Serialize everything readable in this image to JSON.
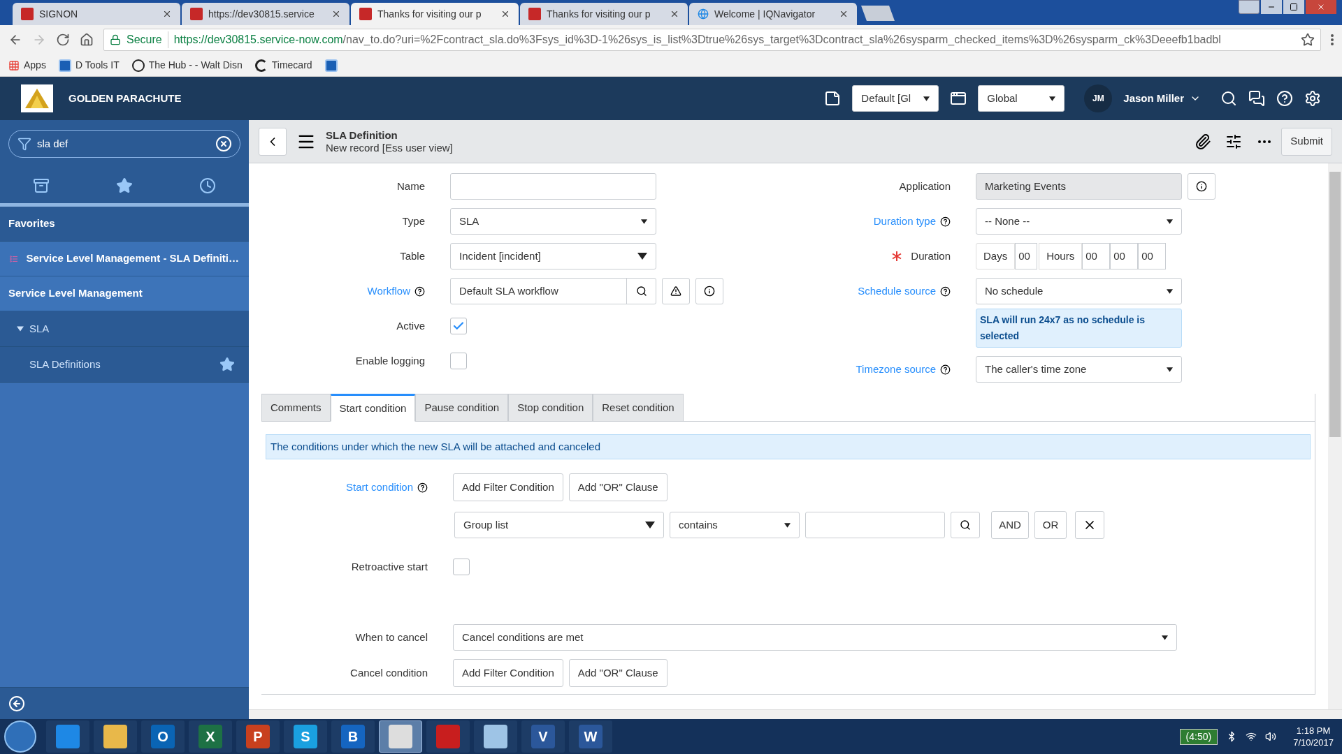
{
  "browser": {
    "tabs": [
      {
        "title": "SIGNON",
        "selected": false
      },
      {
        "title": "https://dev30815.service",
        "selected": false
      },
      {
        "title": "Thanks for visiting our p",
        "selected": true
      },
      {
        "title": "Thanks for visiting our p",
        "selected": false
      },
      {
        "title": "Welcome | IQNavigator",
        "selected": false
      }
    ],
    "secure_label": "Secure",
    "url_host": "https://dev30815.service-now.com",
    "url_path": "/nav_to.do?uri=%2Fcontract_sla.do%3Fsys_id%3D-1%26sys_is_list%3Dtrue%26sys_target%3Dcontract_sla%26sysparm_checked_items%3D%26sysparm_ck%3Deeefb1badbl",
    "bookmarks": [
      {
        "label": "Apps"
      },
      {
        "label": "D Tools IT"
      },
      {
        "label": "The Hub - - Walt Disn"
      },
      {
        "label": "Timecard"
      }
    ]
  },
  "header": {
    "brand": "GOLDEN PARACHUTE",
    "selects": [
      "Default [Gl",
      "Global"
    ],
    "user_initials": "JM",
    "user_name": "Jason Miller"
  },
  "sidebar": {
    "filter": "sla def",
    "favorites_heading": "Favorites",
    "items": [
      {
        "kind": "favorite",
        "label": "Service Level Management - SLA Definiti…"
      },
      {
        "kind": "application",
        "label": "Service Level Management"
      },
      {
        "kind": "group",
        "label": "SLA",
        "expanded": true
      },
      {
        "kind": "module",
        "label": "SLA Definitions",
        "starred": true
      }
    ]
  },
  "form": {
    "title": "SLA Definition",
    "subtitle": "New record [Ess user view]",
    "submit": "Submit",
    "left_fields": [
      {
        "kind": "text",
        "label": "Name"
      },
      {
        "kind": "select",
        "label": "Type",
        "value": "SLA"
      },
      {
        "kind": "table",
        "label": "Table",
        "value": "Incident [incident]"
      },
      {
        "kind": "reference",
        "label": "Workflow",
        "value": "Default SLA workflow",
        "help": true
      },
      {
        "kind": "checkbox",
        "label": "Active",
        "checked": true
      },
      {
        "kind": "checkbox",
        "label": "Enable logging",
        "checked": false
      }
    ],
    "right_fields": [
      {
        "kind": "readonly",
        "label": "Application",
        "value": "Marketing Events"
      },
      {
        "kind": "select",
        "label": "Duration type",
        "value": "-- None --",
        "help": true
      },
      {
        "kind": "duration",
        "label": "Duration",
        "mandatory": true,
        "days_label": "Days",
        "days": "00",
        "hours_label": "Hours",
        "hours": "00",
        "minutes": "00",
        "seconds": "00"
      },
      {
        "kind": "select",
        "label": "Schedule source",
        "value": "No schedule",
        "help": true,
        "note": "SLA will run 24x7 as no schedule is selected"
      },
      {
        "kind": "select",
        "label": "Timezone source",
        "value": "The caller's time zone",
        "help": true
      }
    ],
    "tabs": [
      {
        "label": "Comments",
        "selected": false
      },
      {
        "label": "Start condition",
        "selected": true
      },
      {
        "label": "Pause condition",
        "selected": false
      },
      {
        "label": "Stop condition",
        "selected": false
      },
      {
        "label": "Reset condition",
        "selected": false
      }
    ],
    "info": "The conditions under which the new SLA will be attached and canceled",
    "start_condition": {
      "label": "Start condition",
      "add_filter": "Add Filter Condition",
      "add_or": "Add \"OR\" Clause",
      "field": "Group list",
      "operator": "contains",
      "and": "AND",
      "or": "OR"
    },
    "retroactive": {
      "label": "Retroactive start",
      "checked": false
    },
    "when_to_cancel": {
      "label": "When to cancel",
      "value": "Cancel conditions are met"
    },
    "cancel_condition": {
      "label": "Cancel condition",
      "add_filter": "Add Filter Condition",
      "add_or": "Add \"OR\" Clause"
    }
  },
  "taskbar": {
    "apps": [
      {
        "color": "#1e88e5",
        "selected": false
      },
      {
        "color": "#e8b84a",
        "selected": false
      },
      {
        "label": "O",
        "color": "#0a64b4",
        "selected": false
      },
      {
        "label": "X",
        "color": "#1d7144",
        "selected": false
      },
      {
        "label": "P",
        "color": "#c8401e",
        "selected": false
      },
      {
        "label": "S",
        "color": "#1aa0e0",
        "selected": false
      },
      {
        "label": "B",
        "color": "#1565c0",
        "selected": false
      },
      {
        "color": "#dddddd",
        "selected": true
      },
      {
        "color": "#c81e1e",
        "selected": false
      },
      {
        "color": "#9ec4e6",
        "selected": false
      },
      {
        "label": "V",
        "color": "#2b579a",
        "selected": false
      },
      {
        "label": "W",
        "color": "#2b579a",
        "selected": false
      }
    ],
    "battery": "(4:50)",
    "time": "1:18 PM",
    "date": "7/10/2017"
  }
}
